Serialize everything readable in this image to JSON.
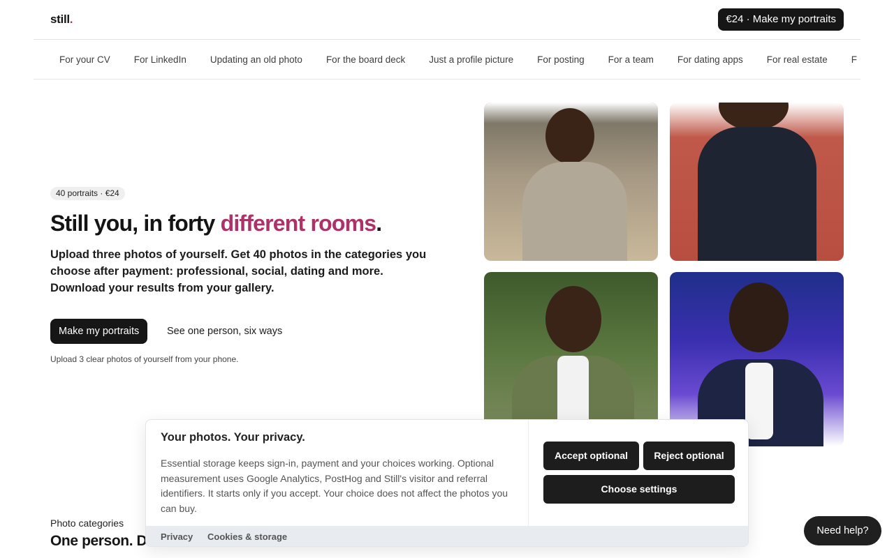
{
  "header": {
    "logo_text": "still",
    "logo_dot": ".",
    "cta_label": "€24 · Make my portraits"
  },
  "categories": [
    "For your CV",
    "For LinkedIn",
    "Updating an old photo",
    "For the board deck",
    "Just a profile picture",
    "For posting",
    "For a team",
    "For dating apps",
    "For real estate",
    "F"
  ],
  "hero": {
    "badge": "40 portraits · €24",
    "title_start": "Still you, in forty ",
    "title_accent": "different rooms",
    "title_end": ".",
    "subtitle": "Upload three photos of yourself. Get 40 photos in the categories you choose after payment: professional, social, dating and more. Download your results from your gallery.",
    "primary_button": "Make my portraits",
    "secondary_link": "See one person, six ways",
    "note": "Upload 3 clear photos of yourself from your phone."
  },
  "cookie": {
    "title": "Your photos. Your privacy.",
    "body": "Essential storage keeps sign-in, payment and your choices working. Optional measurement uses Google Analytics, PostHog and Still's visitor and referral identifiers. It starts only if you accept. Your choice does not affect the photos you can buy.",
    "accept": "Accept optional",
    "reject": "Reject optional",
    "settings": "Choose settings",
    "footer_privacy": "Privacy",
    "footer_cookies": "Cookies & storage"
  },
  "section": {
    "label": "Photo categories",
    "title": "One person. Di"
  },
  "help": {
    "label": "Need help?"
  },
  "colors": {
    "accent": "#ad3268",
    "dark": "#161616"
  }
}
